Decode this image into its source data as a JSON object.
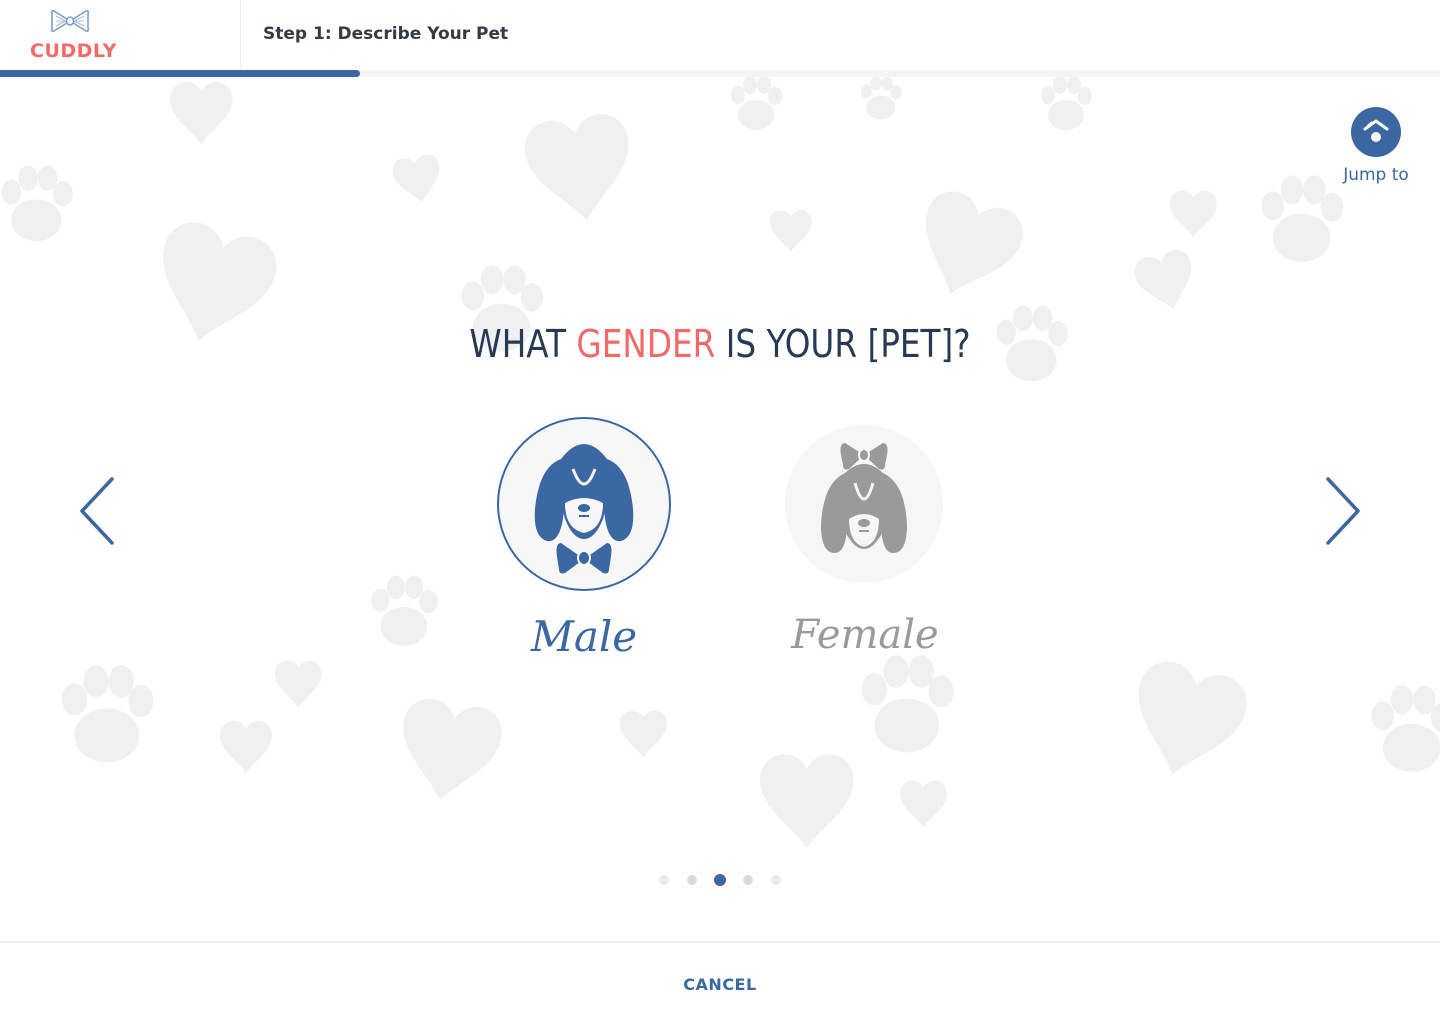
{
  "app": {
    "logo_text": "CUDDLY",
    "brand_color": "#f06a6a",
    "accent_color": "#3b68a3"
  },
  "header": {
    "step_title": "Step 1: Describe Your Pet",
    "progress_fraction": 0.25
  },
  "jump": {
    "label": "Jump to",
    "icon": "jump-to-icon"
  },
  "question": {
    "prefix": "WHAT ",
    "highlight": "GENDER",
    "suffix": " IS YOUR [PET]?"
  },
  "options": [
    {
      "label": "Male",
      "selected": true,
      "icon": "male-dog-bowtie-icon"
    },
    {
      "label": "Female",
      "selected": false,
      "icon": "female-dog-bow-icon"
    }
  ],
  "navigation": {
    "prev_icon": "chevron-left-icon",
    "next_icon": "chevron-right-icon"
  },
  "pager": {
    "total": 5,
    "current": 3
  },
  "footer": {
    "cancel_label": "CANCEL"
  }
}
